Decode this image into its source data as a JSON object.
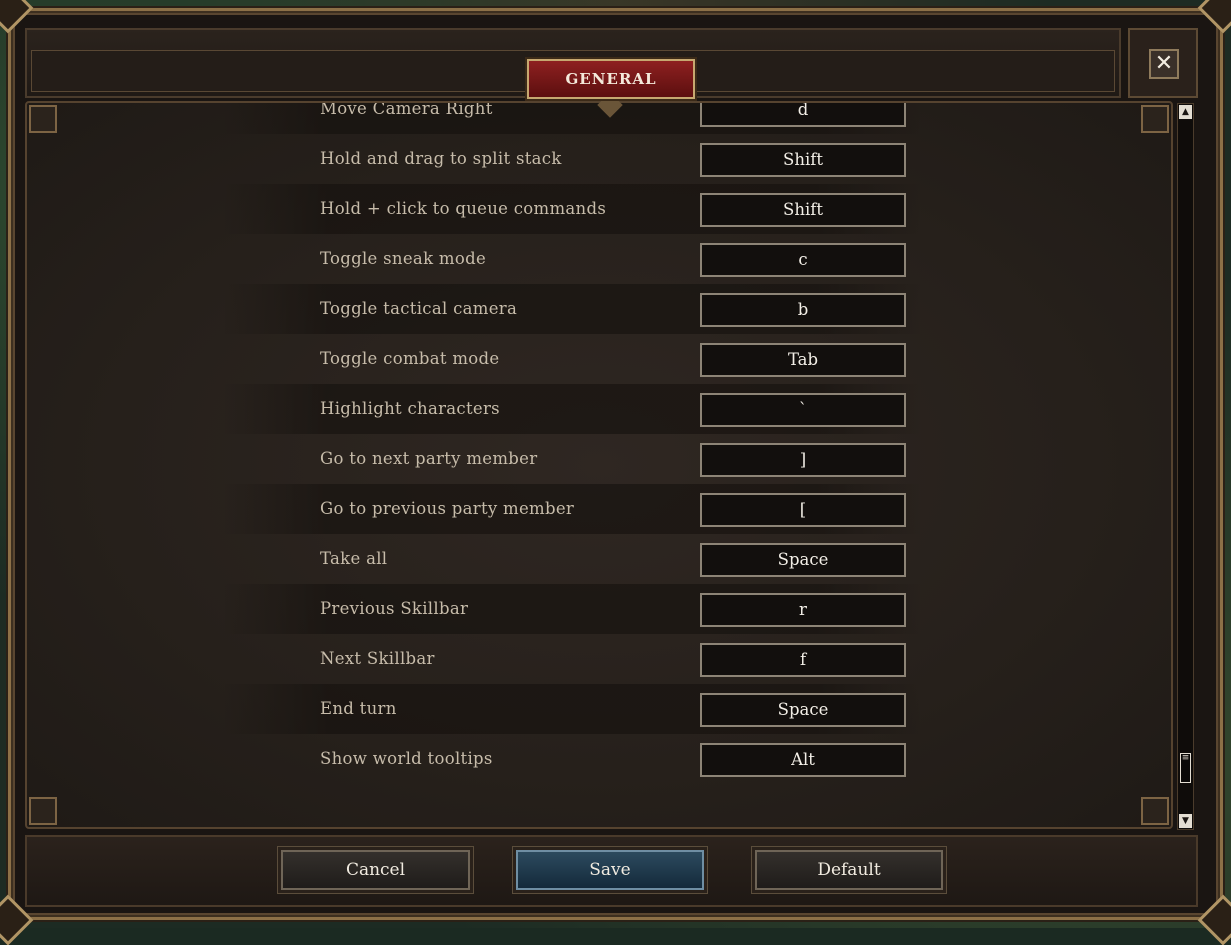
{
  "tab": {
    "label": "GENERAL"
  },
  "close": {
    "glyph": "✕"
  },
  "keybindings": [
    {
      "action": "Move Camera Right",
      "key": "d"
    },
    {
      "action": "Hold and drag to split stack",
      "key": "Shift"
    },
    {
      "action": "Hold + click to queue commands",
      "key": "Shift"
    },
    {
      "action": "Toggle sneak mode",
      "key": "c"
    },
    {
      "action": "Toggle tactical camera",
      "key": "b"
    },
    {
      "action": "Toggle combat mode",
      "key": "Tab"
    },
    {
      "action": "Highlight characters",
      "key": "`"
    },
    {
      "action": "Go to next party member",
      "key": "]"
    },
    {
      "action": "Go to previous party member",
      "key": "["
    },
    {
      "action": "Take all",
      "key": "Space"
    },
    {
      "action": "Previous Skillbar",
      "key": "r"
    },
    {
      "action": "Next Skillbar",
      "key": "f"
    },
    {
      "action": "End turn",
      "key": "Space"
    },
    {
      "action": "Show world tooltips",
      "key": "Alt"
    }
  ],
  "scrollbar": {
    "up": "▲",
    "down": "▼",
    "thumb": "≡",
    "position": 0.95
  },
  "footer": {
    "cancel_label": "Cancel",
    "save_label": "Save",
    "default_label": "Default"
  },
  "colors": {
    "tab_accent": "#8e2020",
    "save_accent": "#2c4a5e",
    "frame_gold": "#8c7047"
  }
}
